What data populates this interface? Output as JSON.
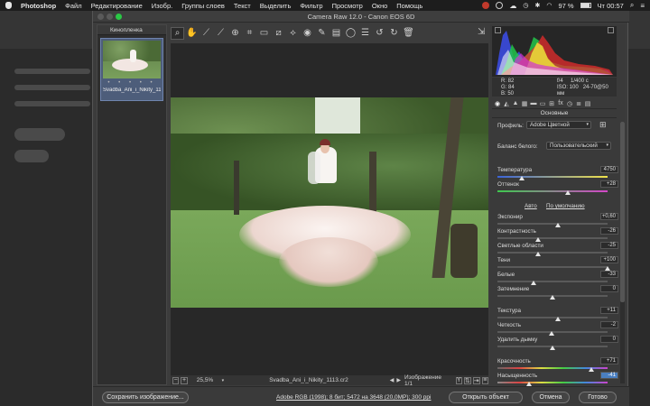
{
  "menubar": {
    "app": "Photoshop",
    "items": [
      "Файл",
      "Редактирование",
      "Изобр.",
      "Группы слоев",
      "Текст",
      "Выделить",
      "Фильтр",
      "Просмотр",
      "Окно",
      "Помощь"
    ],
    "battery": "97 %",
    "clock": "Чт 00:57"
  },
  "window": {
    "title": "Camera Raw 12.0  -  Canon EOS 6D"
  },
  "filmstrip": {
    "header": "Кинопленка",
    "stars": "• • • • •",
    "thumb_name": "Svadba_Ani_i_Nikity_1113..."
  },
  "toolbar": {
    "tools": [
      "zoom-icon",
      "hand-icon",
      "white-balance-icon",
      "color-sampler-icon",
      "target-adjust-icon",
      "crop-icon",
      "straighten-icon",
      "transform-icon",
      "spot-removal-icon",
      "red-eye-icon",
      "adjustment-brush-icon",
      "graduated-filter-icon",
      "radial-filter-icon",
      "preferences-icon",
      "rotate-left-icon",
      "rotate-right-icon",
      "trash-icon"
    ]
  },
  "status": {
    "zoom": "25,5%",
    "filename": "Svadba_Ani_i_Nikity_1113.cr2",
    "image_count": "Изображение 1/1"
  },
  "readout": {
    "r": "R:  82",
    "g": "G:  84",
    "b": "B:  50",
    "aperture": "f/4",
    "shutter": "1/400 с",
    "iso": "ISO: 100",
    "lens": "24-70@50 мм"
  },
  "panel": {
    "section": "Основные",
    "profile_label": "Профиль:",
    "profile_value": "Adobe Цветной",
    "wb_label": "Баланс белого:",
    "wb_value": "Пользовательский",
    "auto": "Авто",
    "default": "По умолчанию",
    "sliders": [
      {
        "label": "Температура",
        "value": "4750",
        "pos": 0.22
      },
      {
        "label": "Оттенок",
        "value": "+28",
        "pos": 0.64
      },
      {
        "label": "Экспонир",
        "value": "+0,60",
        "pos": 0.55
      },
      {
        "label": "Контрастность",
        "value": "-26",
        "pos": 0.37
      },
      {
        "label": "Светлые области",
        "value": "-25",
        "pos": 0.37
      },
      {
        "label": "Тени",
        "value": "+100",
        "pos": 1.0
      },
      {
        "label": "Белые",
        "value": "-33",
        "pos": 0.33
      },
      {
        "label": "Затемнение",
        "value": "0",
        "pos": 0.5
      },
      {
        "label": "Текстура",
        "value": "+11",
        "pos": 0.55
      },
      {
        "label": "Четкость",
        "value": "-2",
        "pos": 0.49
      },
      {
        "label": "Удалить дымку",
        "value": "0",
        "pos": 0.5
      },
      {
        "label": "Красочность",
        "value": "+71",
        "pos": 0.85
      },
      {
        "label": "Насыщенность",
        "value": "-41",
        "pos": 0.29
      }
    ]
  },
  "footer": {
    "save": "Сохранить изображение...",
    "workflow": "Adobe RGB (1998); 8 бит; 5472 на 3648 (20,0MP); 300 ppi",
    "open": "Открыть объект",
    "cancel": "Отмена",
    "done": "Готово"
  }
}
